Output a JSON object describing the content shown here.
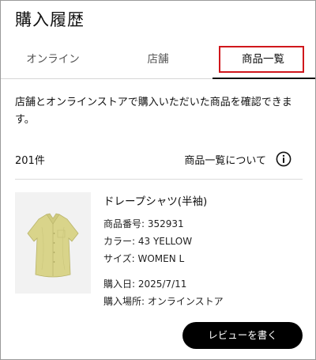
{
  "page": {
    "title": "購入履歴"
  },
  "tabs": [
    {
      "label": "オンライン",
      "active": false
    },
    {
      "label": "店舗",
      "active": false
    },
    {
      "label": "商品一覧",
      "active": true
    }
  ],
  "intro": {
    "text": "店舗とオンラインストアで購入いただいた商品を確認できます。"
  },
  "summary": {
    "count": "201件",
    "about_label": "商品一覧について",
    "about_icon": "info-icon"
  },
  "items": [
    {
      "name": "ドレープシャツ(半袖)",
      "product_number": "商品番号: 352931",
      "color": "カラー: 43 YELLOW",
      "size": "サイズ: WOMEN L",
      "purchase_date": "購入日: 2025/7/11",
      "purchase_place": "購入場所: オンラインストア",
      "review_label": "レビューを書く",
      "image_color": "#d9d48a"
    }
  ],
  "colors": {
    "highlight": "#d0171c",
    "button": "#000000",
    "product": "#d9d48a"
  }
}
